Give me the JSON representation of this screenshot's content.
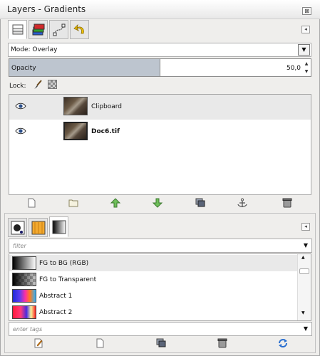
{
  "window": {
    "title": "Layers - Gradients",
    "close_glyph": "⊠"
  },
  "layers_dock": {
    "tabs": [
      {
        "name": "layers",
        "icon": "layers-stack-icon"
      },
      {
        "name": "channels",
        "icon": "channels-icon"
      },
      {
        "name": "paths",
        "icon": "paths-icon"
      },
      {
        "name": "undo-history",
        "icon": "undo-history-icon"
      }
    ],
    "menu_glyph": "◂"
  },
  "mode": {
    "label": "Mode: Overlay",
    "dropdown_glyph": "▼"
  },
  "opacity": {
    "label": "Opacity",
    "value": "50,0",
    "fraction": 0.5,
    "up_glyph": "▲",
    "down_glyph": "▼"
  },
  "lock": {
    "label": "Lock:",
    "icons": [
      "paintbrush-icon",
      "alpha-checker-icon"
    ]
  },
  "layers": [
    {
      "name": "Clipboard",
      "visible": true,
      "selected": true,
      "bold": false
    },
    {
      "name": "Doc6.tif",
      "visible": true,
      "selected": false,
      "bold": true
    }
  ],
  "layer_buttons": [
    "new-layer-icon",
    "new-layer-group-icon",
    "raise-layer-icon",
    "lower-layer-icon",
    "duplicate-layer-icon",
    "anchor-layer-icon",
    "delete-layer-icon"
  ],
  "gradients_dock": {
    "tabs": [
      {
        "name": "brushes",
        "icon": "brush-tab-icon"
      },
      {
        "name": "patterns",
        "icon": "pattern-tab-icon"
      },
      {
        "name": "gradients",
        "icon": "gradient-tab-icon"
      }
    ],
    "menu_glyph": "◂"
  },
  "filter": {
    "placeholder": "filter",
    "dropdown_glyph": "▼"
  },
  "gradients": [
    {
      "name": "FG to BG (RGB)",
      "selected": true
    },
    {
      "name": "FG to Transparent",
      "selected": false
    },
    {
      "name": "Abstract 1",
      "selected": false
    },
    {
      "name": "Abstract 2",
      "selected": false
    }
  ],
  "scrollbar": {
    "up_glyph": "▲",
    "down_glyph": "▼"
  },
  "tags": {
    "placeholder": "enter tags",
    "dropdown_glyph": "▼"
  },
  "gradient_buttons": [
    "edit-gradient-icon",
    "new-gradient-icon",
    "duplicate-gradient-icon",
    "delete-gradient-icon",
    "refresh-gradients-icon"
  ],
  "colors": {
    "selection": "#bdc5cf",
    "row_selected": "#e9e9e9"
  }
}
